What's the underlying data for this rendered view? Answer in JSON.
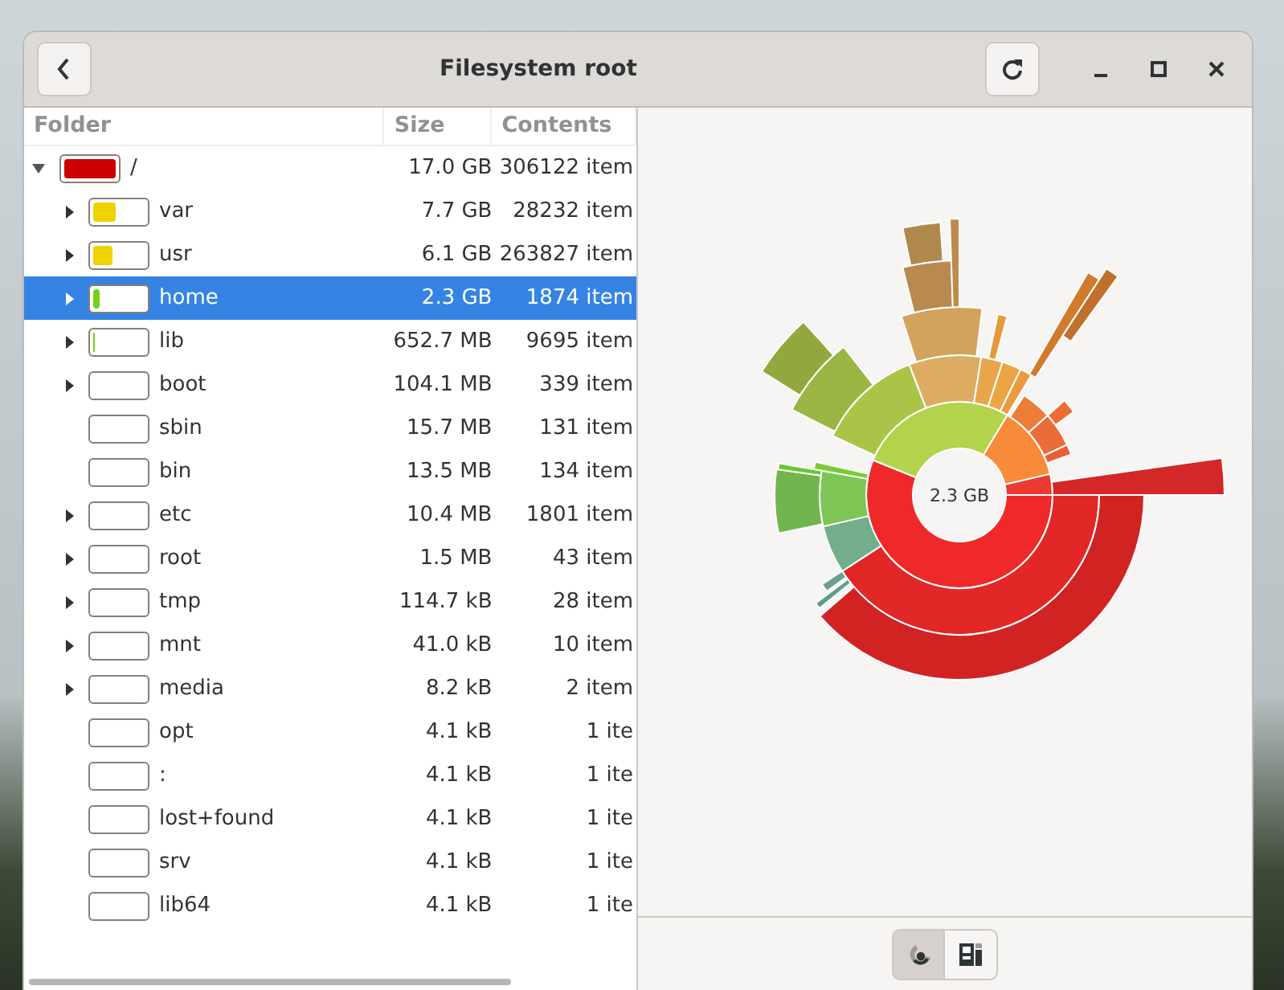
{
  "window": {
    "title": "Filesystem root"
  },
  "columns": [
    "Folder",
    "Size",
    "Contents"
  ],
  "tree": [
    {
      "name": "/",
      "size": "17.0 GB",
      "contents": "306122 item",
      "expandable": true,
      "expanded": true,
      "selected": false,
      "level": 1.0,
      "color": "#cc0000",
      "children": [
        {
          "name": "var",
          "size": "7.7 GB",
          "contents": "28232 item",
          "expandable": true,
          "expanded": false,
          "selected": false,
          "level": 0.45,
          "color": "#edd400"
        },
        {
          "name": "usr",
          "size": "6.1 GB",
          "contents": "263827 item",
          "expandable": true,
          "expanded": false,
          "selected": false,
          "level": 0.36,
          "color": "#edd400"
        },
        {
          "name": "home",
          "size": "2.3 GB",
          "contents": "1874 item",
          "expandable": true,
          "expanded": false,
          "selected": true,
          "level": 0.14,
          "color": "#73d216"
        },
        {
          "name": "lib",
          "size": "652.7 MB",
          "contents": "9695 item",
          "expandable": true,
          "expanded": false,
          "selected": false,
          "level": 0.04,
          "color": "#73d216"
        },
        {
          "name": "boot",
          "size": "104.1 MB",
          "contents": "339 item",
          "expandable": true,
          "expanded": false,
          "selected": false
        },
        {
          "name": "sbin",
          "size": "15.7 MB",
          "contents": "131 item",
          "expandable": false,
          "selected": false
        },
        {
          "name": "bin",
          "size": "13.5 MB",
          "contents": "134 item",
          "expandable": false,
          "selected": false
        },
        {
          "name": "etc",
          "size": "10.4 MB",
          "contents": "1801 item",
          "expandable": true,
          "expanded": false,
          "selected": false
        },
        {
          "name": "root",
          "size": "1.5 MB",
          "contents": "43 item",
          "expandable": true,
          "expanded": false,
          "selected": false
        },
        {
          "name": "tmp",
          "size": "114.7 kB",
          "contents": "28 item",
          "expandable": true,
          "expanded": false,
          "selected": false
        },
        {
          "name": "mnt",
          "size": "41.0 kB",
          "contents": "10 item",
          "expandable": true,
          "expanded": false,
          "selected": false
        },
        {
          "name": "media",
          "size": "8.2 kB",
          "contents": "2 item",
          "expandable": true,
          "expanded": false,
          "selected": false
        },
        {
          "name": "opt",
          "size": "4.1 kB",
          "contents": "1 ite",
          "expandable": false,
          "selected": false
        },
        {
          "name": ":",
          "size": "4.1 kB",
          "contents": "1 ite",
          "expandable": false,
          "selected": false
        },
        {
          "name": "lost+found",
          "size": "4.1 kB",
          "contents": "1 ite",
          "expandable": false,
          "selected": false
        },
        {
          "name": "srv",
          "size": "4.1 kB",
          "contents": "1 ite",
          "expandable": false,
          "selected": false
        },
        {
          "name": "lib64",
          "size": "4.1 kB",
          "contents": "1 ite",
          "expandable": false,
          "selected": false
        }
      ]
    }
  ],
  "chart": {
    "center_label": "2.3 GB"
  },
  "view_switcher": [
    {
      "kind": "rings",
      "selected": true
    },
    {
      "kind": "treemap",
      "selected": false
    }
  ]
}
